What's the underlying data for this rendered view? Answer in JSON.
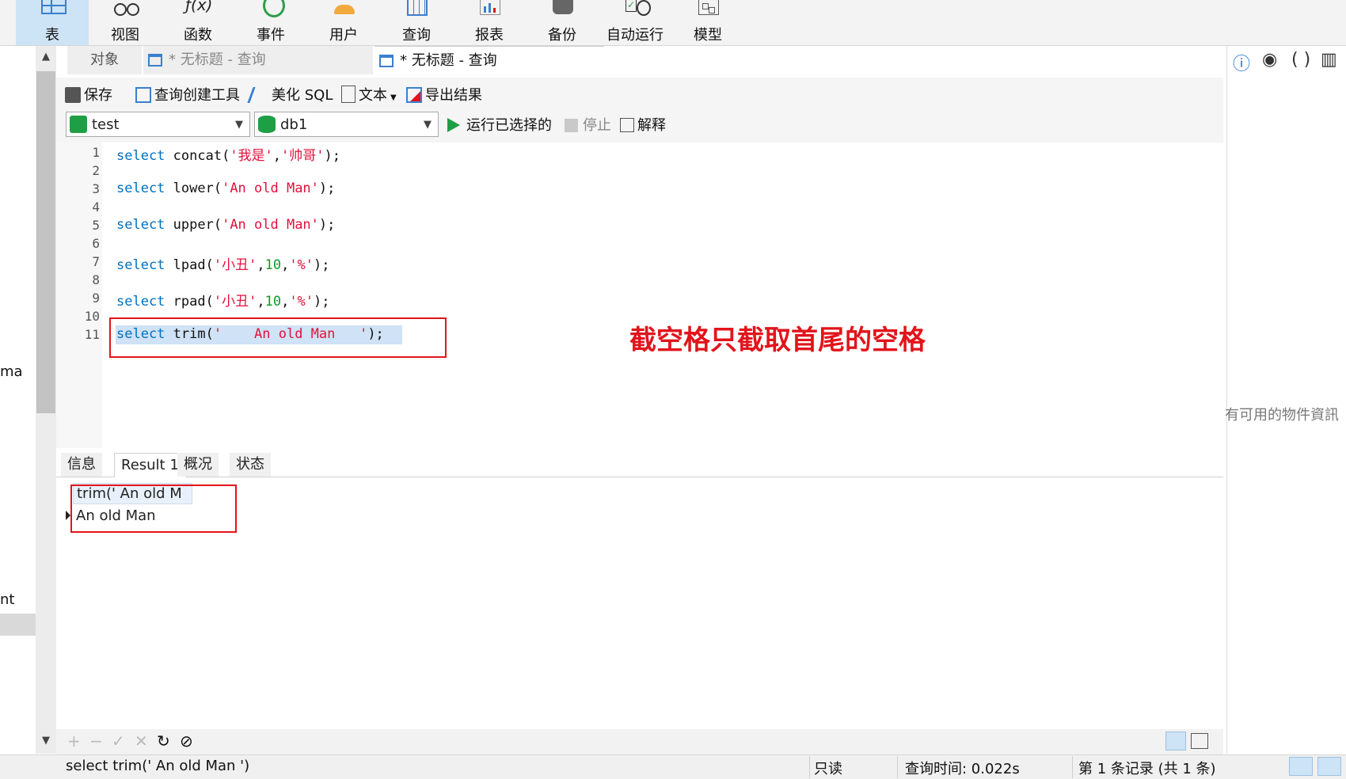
{
  "ribbon": {
    "items": [
      {
        "label": "表",
        "icon": "table-icon"
      },
      {
        "label": "视图",
        "icon": "view-icon"
      },
      {
        "label": "函数",
        "icon": "function-icon"
      },
      {
        "label": "事件",
        "icon": "event-icon"
      },
      {
        "label": "用户",
        "icon": "user-icon"
      },
      {
        "label": "查询",
        "icon": "query-icon"
      },
      {
        "label": "报表",
        "icon": "report-icon"
      },
      {
        "label": "备份",
        "icon": "backup-icon"
      },
      {
        "label": "自动运行",
        "icon": "autorun-icon"
      },
      {
        "label": "模型",
        "icon": "model-icon"
      }
    ]
  },
  "left_panel": {
    "cut_text_1": "ma",
    "cut_text_2": "nt"
  },
  "tabs": {
    "objects": "对象",
    "tab1": "* 无标题 - 查询",
    "tab2": "* 无标题 - 查询"
  },
  "toolbar": {
    "save": "保存",
    "query_builder": "查询创建工具",
    "beautify": "美化 SQL",
    "text": "文本",
    "export": "导出结果"
  },
  "connection": {
    "connection_value": "test",
    "database_value": "db1",
    "run_selected": "运行已选择的",
    "stop": "停止",
    "explain": "解释"
  },
  "editor": {
    "line_numbers": [
      "1",
      "2",
      "3",
      "4",
      "5",
      "6",
      "7",
      "8",
      "9",
      "10",
      "11"
    ],
    "line1": {
      "kw": "select",
      "fn": " concat(",
      "s1": "'我是'",
      "sep": ",",
      "s2": "'帅哥'",
      "end": ");"
    },
    "line3": {
      "kw": "select",
      "fn": " lower(",
      "s1": "'An old Man'",
      "end": ");"
    },
    "line5": {
      "kw": "select",
      "fn": " upper(",
      "s1": "'An old Man'",
      "end": ");"
    },
    "line7": {
      "kw": "select",
      "fn": " lpad(",
      "s1": "'小丑'",
      "sep1": ",",
      "n": "10",
      "sep2": ",",
      "s2": "'%'",
      "end": ");"
    },
    "line9": {
      "kw": "select",
      "fn": " rpad(",
      "s1": "'小丑'",
      "sep1": ",",
      "n": "10",
      "sep2": ",",
      "s2": "'%'",
      "end": ");"
    },
    "line11": {
      "kw": "select",
      "fn": " trim(",
      "s1": "'    An old Man   '",
      "end": ");"
    },
    "annotation": "截空格只截取首尾的空格"
  },
  "result_tabs": [
    "信息",
    "Result 1",
    "概况",
    "状态"
  ],
  "result_grid": {
    "column": "trim('    An old M",
    "value": "An old Man"
  },
  "grid_tools": [
    "+",
    "−",
    "✓",
    "✕",
    "↻",
    "⊘"
  ],
  "status": {
    "sql": "select trim('    An old Man   ')",
    "readonly": "只读",
    "query_time": "查询时间: 0.022s",
    "records": "第 1 条记录 (共 1 条)"
  },
  "right_panel": {
    "text": "有可用的物件資訊"
  }
}
